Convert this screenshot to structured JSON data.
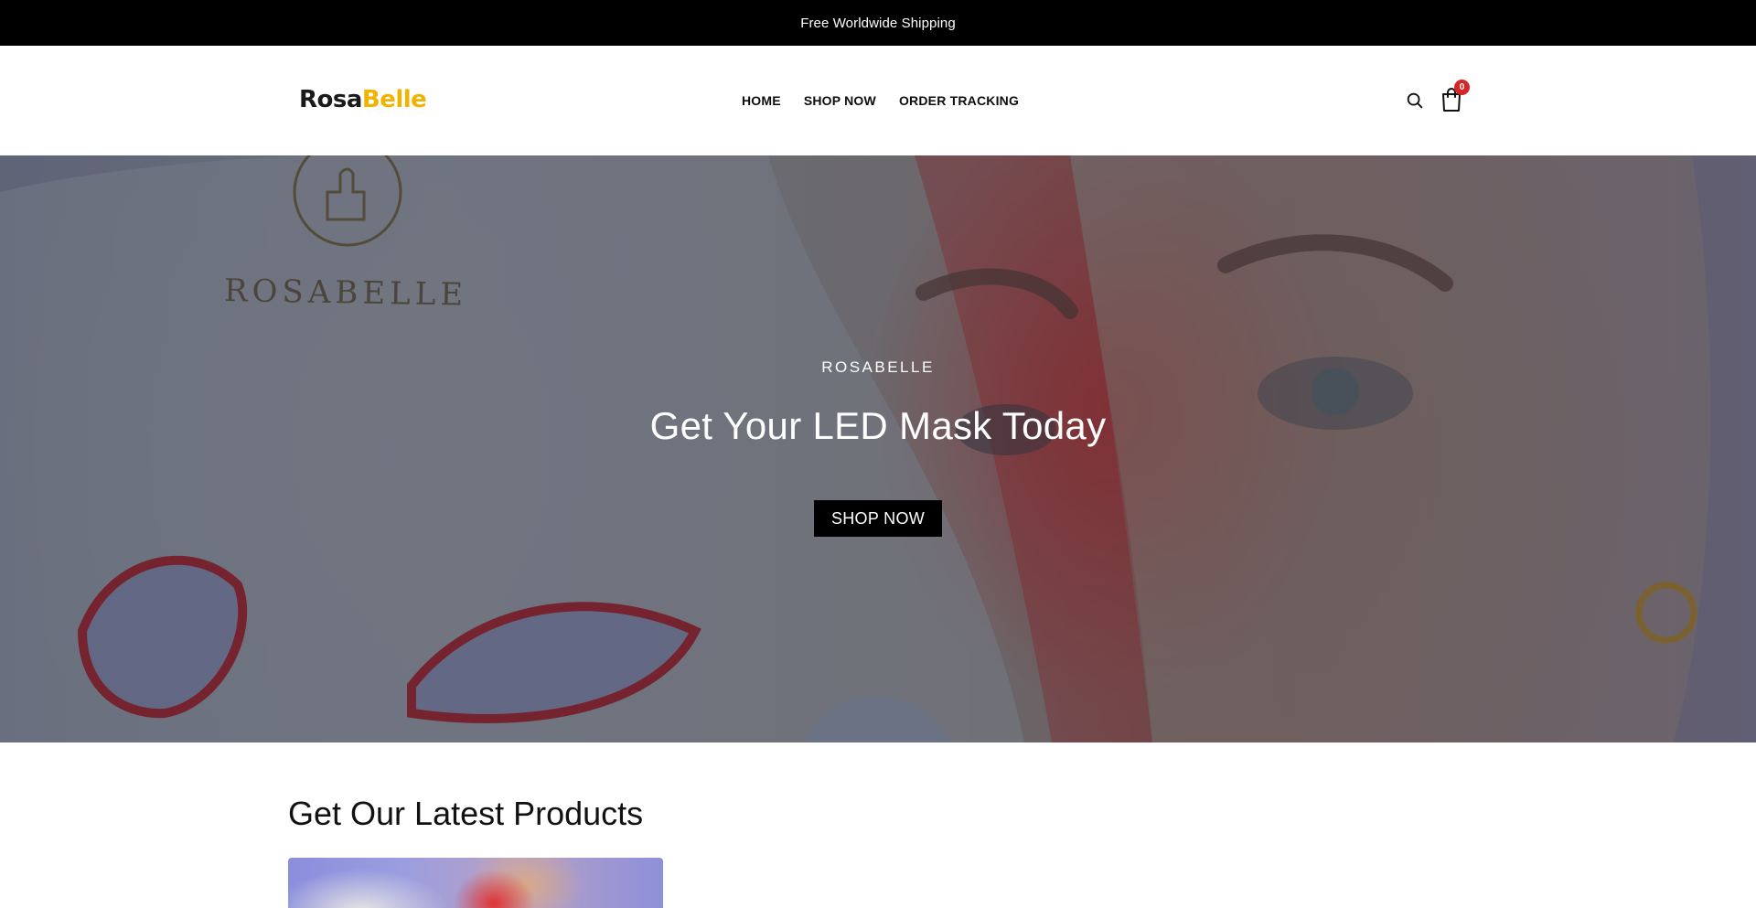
{
  "announcement": {
    "text": "Free Worldwide Shipping"
  },
  "header": {
    "logo": {
      "part1": "Rosa",
      "part2": "Belle"
    },
    "nav": [
      {
        "label": "HOME"
      },
      {
        "label": "SHOP NOW"
      },
      {
        "label": "ORDER TRACKING"
      }
    ],
    "cart_count": "0"
  },
  "hero": {
    "eyebrow": "ROSABELLE",
    "mask_imprint": "ROSABELLE",
    "title": "Get Your LED Mask Today",
    "button_label": "SHOP NOW"
  },
  "products": {
    "section_title": "Get Our Latest Products"
  },
  "colors": {
    "announcement_bg": "#000000",
    "logo_accent": "#f2b300",
    "cart_badge": "#d32626",
    "button_bg": "#000000"
  },
  "icons": {
    "search": "search-icon",
    "cart": "shopping-bag-icon"
  }
}
